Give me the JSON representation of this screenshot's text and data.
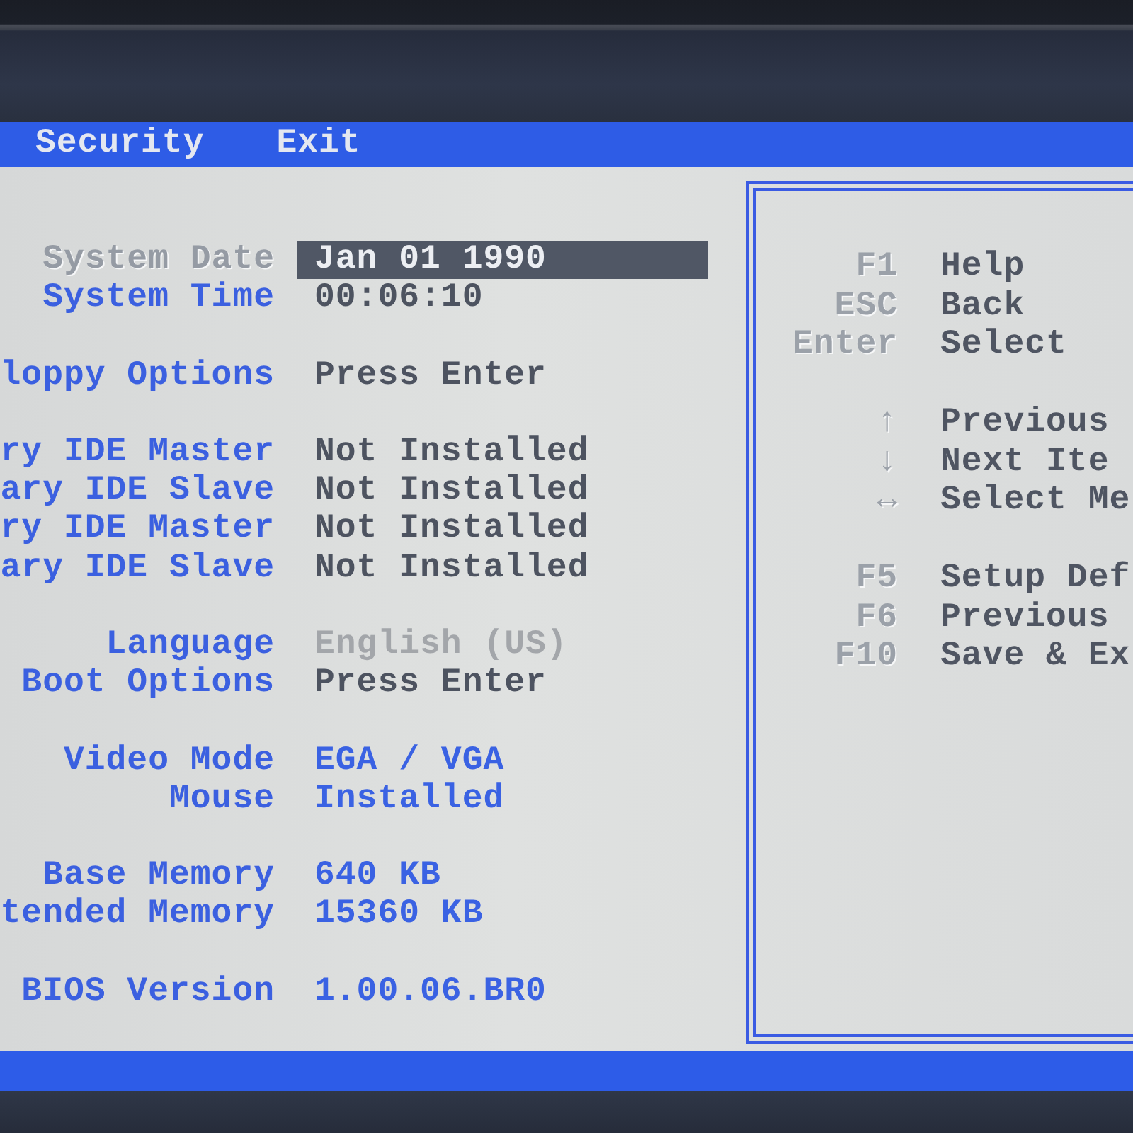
{
  "menu_bar": {
    "tabs": [
      {
        "label": "Security",
        "selected": false
      },
      {
        "label": "Exit",
        "selected": false
      }
    ]
  },
  "settings": [
    {
      "items": [
        {
          "label": "System Date",
          "value": "Jan 01 1990",
          "kind": "setting",
          "selected": true,
          "disabled": false
        },
        {
          "label": "System Time",
          "value": "00:06:10",
          "kind": "setting",
          "selected": false,
          "disabled": false
        }
      ]
    },
    {
      "items": [
        {
          "label": "loppy Options",
          "value": "Press Enter",
          "kind": "setting",
          "selected": false,
          "disabled": false
        }
      ]
    },
    {
      "items": [
        {
          "label": "ry IDE Master",
          "value": "Not Installed",
          "kind": "setting",
          "selected": false,
          "disabled": false
        },
        {
          "label": "ary IDE Slave",
          "value": "Not Installed",
          "kind": "setting",
          "selected": false,
          "disabled": false
        },
        {
          "label": "ry IDE Master",
          "value": "Not Installed",
          "kind": "setting",
          "selected": false,
          "disabled": false
        },
        {
          "label": "ary IDE Slave",
          "value": "Not Installed",
          "kind": "setting",
          "selected": false,
          "disabled": false
        }
      ]
    },
    {
      "items": [
        {
          "label": "Language",
          "value": "English (US)",
          "kind": "setting",
          "selected": false,
          "disabled": true
        },
        {
          "label": "Boot Options",
          "value": "Press Enter",
          "kind": "setting",
          "selected": false,
          "disabled": false
        }
      ]
    },
    {
      "items": [
        {
          "label": "Video Mode",
          "value": "EGA / VGA",
          "kind": "info",
          "selected": false,
          "disabled": false
        },
        {
          "label": "Mouse",
          "value": "Installed",
          "kind": "info",
          "selected": false,
          "disabled": false
        }
      ]
    },
    {
      "items": [
        {
          "label": "Base Memory",
          "value": "640 KB",
          "kind": "info",
          "selected": false,
          "disabled": false
        },
        {
          "label": "tended Memory",
          "value": "15360 KB",
          "kind": "info",
          "selected": false,
          "disabled": false
        }
      ]
    },
    {
      "items": [
        {
          "label": "BIOS Version",
          "value": "1.00.06.BR0",
          "kind": "info",
          "selected": false,
          "disabled": false
        }
      ]
    }
  ],
  "help_panel": {
    "groups": [
      {
        "items": [
          {
            "key": "F1",
            "action": "Help"
          },
          {
            "key": "ESC",
            "action": "Back"
          },
          {
            "key": "Enter",
            "action": "Select"
          }
        ]
      },
      {
        "items": [
          {
            "key": "↑",
            "action": "Previous"
          },
          {
            "key": "↓",
            "action": "Next Ite"
          },
          {
            "key": "↔",
            "action": "Select Me"
          }
        ]
      },
      {
        "items": [
          {
            "key": "F5",
            "action": "Setup Def"
          },
          {
            "key": "F6",
            "action": "Previous"
          },
          {
            "key": "F10",
            "action": "Save & Ex"
          }
        ]
      }
    ]
  }
}
